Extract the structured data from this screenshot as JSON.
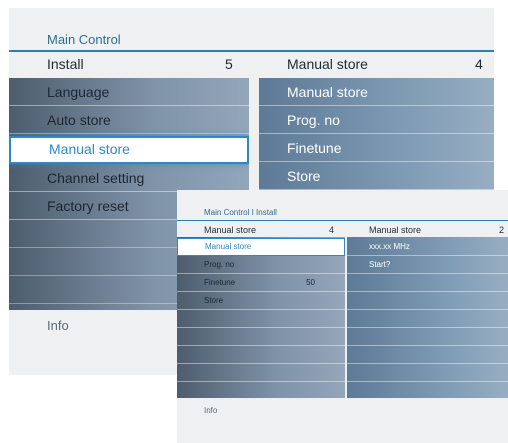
{
  "colors": {
    "accent": "#2e7eaf",
    "panel_bg": "#eef0f1",
    "selection": "#2f88c6"
  },
  "back_menu": {
    "breadcrumb": "Main Control",
    "left_header": {
      "label": "Install",
      "count": "5"
    },
    "right_header": {
      "label": "Manual store",
      "count": "4"
    },
    "left_items": [
      "Language",
      "Auto store",
      "Manual store",
      "Channel setting",
      "Factory reset"
    ],
    "selected_left": "Manual store",
    "right_items": [
      "Manual store",
      "Prog. no",
      "Finetune",
      "Store"
    ],
    "info": "Info"
  },
  "front_menu": {
    "breadcrumb": "Main Control I Install",
    "left_header": {
      "label": "Manual store",
      "count": "4"
    },
    "right_header": {
      "label": "Manual store",
      "count": "2"
    },
    "left_items": [
      {
        "label": "Manual store",
        "value": ""
      },
      {
        "label": "Prog. no",
        "value": ""
      },
      {
        "label": "Finetune",
        "value": "50"
      },
      {
        "label": "Store",
        "value": ""
      }
    ],
    "selected_left": "Manual store",
    "right_items": [
      "xxx.xx MHz",
      "Start?"
    ],
    "info": "Info"
  }
}
